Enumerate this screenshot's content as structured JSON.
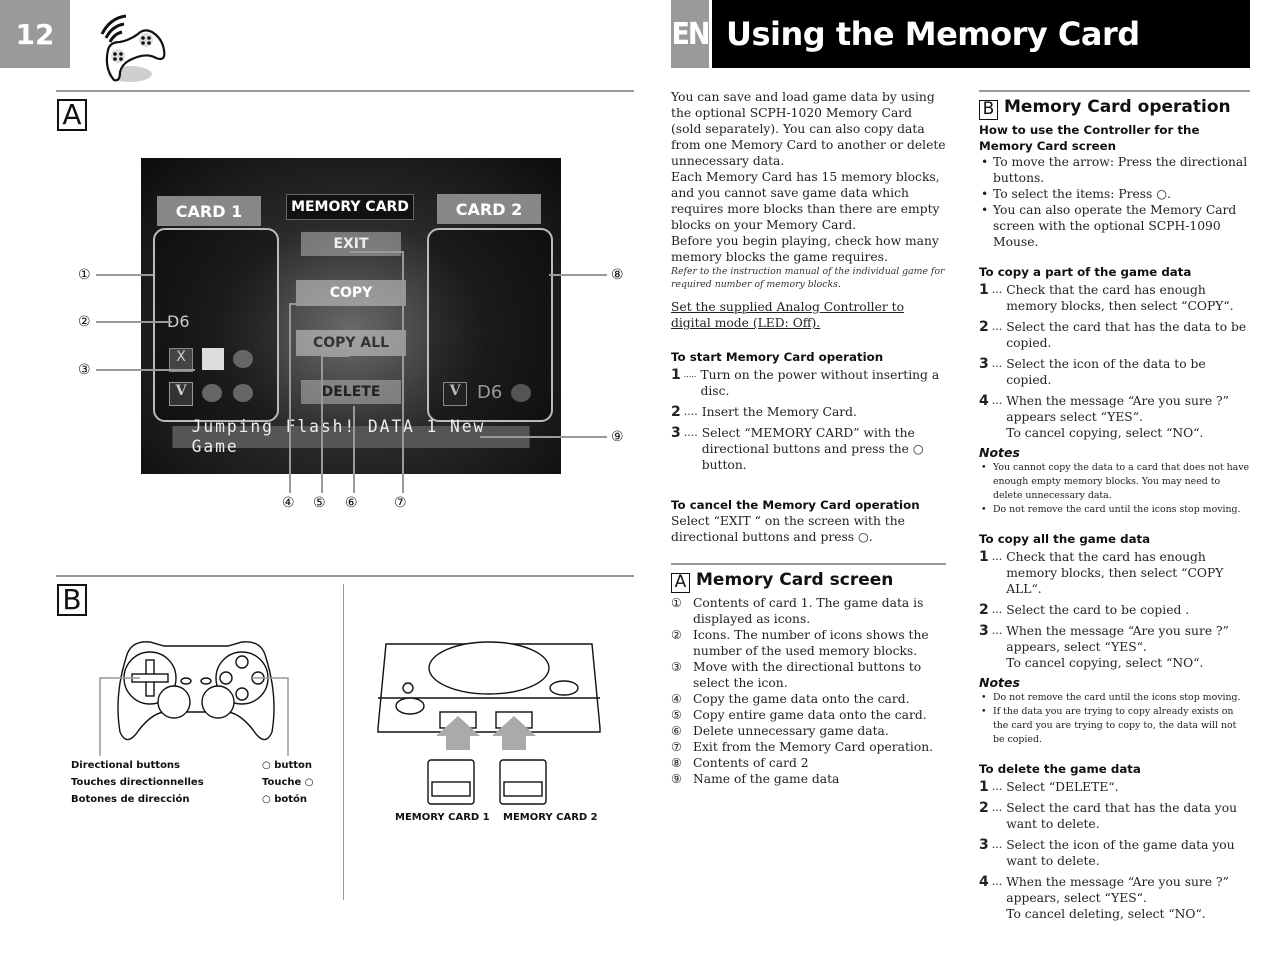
{
  "page_number": "12",
  "language_tab": "EN",
  "page_title": "Using the Memory Card",
  "icons": {
    "header": "controller-icon"
  },
  "figure_a": {
    "label": "A",
    "screen": {
      "card1_label": "CARD 1",
      "card2_label": "CARD 2",
      "header_label": "MEMORY CARD",
      "menu": [
        "EXIT",
        "COPY",
        "COPY ALL",
        "DELETE"
      ],
      "game_data_name": "Jumping Flash! DATA 1 New Game",
      "card1_icons": [
        "D6",
        "X",
        "sketch",
        "3",
        "V",
        "1",
        "2"
      ],
      "card2_icons": [
        "V",
        "D6",
        "2"
      ]
    },
    "callouts": [
      "①",
      "②",
      "③",
      "④",
      "⑤",
      "⑥",
      "⑦",
      "⑧",
      "⑨"
    ]
  },
  "figure_b": {
    "label": "B",
    "controller_labels_left": [
      "Directional buttons",
      "Touches directionnelles",
      "Botones de dirección"
    ],
    "controller_labels_right": [
      "○ button",
      "Touche ○",
      "○ botón"
    ],
    "memory_card_labels": [
      "MEMORY CARD 1",
      "MEMORY CARD 2"
    ]
  },
  "intro": {
    "p1": "You can save and load game data by using the optional SCPH-1020 Memory Card (sold separately). You can also copy data from one Memory Card to another or delete unnecessary data.",
    "p2": "Each Memory Card has 15 memory blocks, and you cannot save game data which requires more blocks than there are empty blocks on your Memory Card.",
    "p3": "Before you begin playing, check how many memory blocks the game requires.",
    "note": "Refer to the instruction manual of the individual game for required number of memory blocks.",
    "underlined": "Set the supplied Analog Controller to digital mode (LED: Off)."
  },
  "start_op": {
    "heading": "To start Memory Card operation",
    "steps": [
      {
        "num": "1",
        "dots": ".....",
        "text": "Turn on the power without inserting a disc."
      },
      {
        "num": "2",
        "dots": "....",
        "text": "Insert the Memory Card."
      },
      {
        "num": "3",
        "dots": "....",
        "text": "Select “MEMORY CARD” with the directional buttons and press the ○ button."
      }
    ]
  },
  "cancel_op": {
    "heading": "To cancel the Memory Card operation",
    "text": "Select “EXIT “ on the screen with the directional buttons and press ○."
  },
  "section_a": {
    "box": "A",
    "title": "Memory Card screen",
    "items": [
      {
        "n": "①",
        "text": "Contents of card 1. The game data is displayed as icons."
      },
      {
        "n": "②",
        "text": "Icons. The number of icons shows the number of the used memory blocks."
      },
      {
        "n": "③",
        "text": "Move with the directional buttons to select the icon."
      },
      {
        "n": "④",
        "text": "Copy the game data onto the card."
      },
      {
        "n": "⑤",
        "text": "Copy entire game data onto the card."
      },
      {
        "n": "⑥",
        "text": "Delete unnecessary game data."
      },
      {
        "n": "⑦",
        "text": "Exit from the Memory Card operation."
      },
      {
        "n": "⑧",
        "text": "Contents of card 2"
      },
      {
        "n": "⑨",
        "text": "Name of the game data"
      }
    ]
  },
  "section_b": {
    "box": "B",
    "title": "Memory Card operation",
    "controller_heading": "How to use the Controller for the Memory Card screen",
    "bullets": [
      "To move the arrow: Press the directional buttons.",
      "To select the items: Press ○.",
      "You can also operate the Memory Card screen with the optional SCPH-1090 Mouse."
    ],
    "copy_part": {
      "heading": "To copy a part of the game data",
      "steps": [
        {
          "num": "1",
          "dots": "...",
          "text": "Check that the card has enough memory blocks, then select “COPY“."
        },
        {
          "num": "2",
          "dots": "...",
          "text": "Select the card that has the data to be copied."
        },
        {
          "num": "3",
          "dots": "...",
          "text": "Select the icon of the data to be copied."
        },
        {
          "num": "4",
          "dots": "...",
          "text": "When the message “Are you sure ?” appears select “YES“.",
          "text2": "To cancel copying, select “NO“."
        }
      ],
      "notes_heading": "Notes",
      "notes": [
        "You cannot copy the data to a card that does not have enough empty memory blocks. You may need to delete unnecessary data.",
        "Do not remove the card until the icons stop moving."
      ]
    },
    "copy_all": {
      "heading": "To copy all the game data",
      "steps": [
        {
          "num": "1",
          "dots": "...",
          "text": "Check that the card has enough memory blocks, then select “COPY ALL“."
        },
        {
          "num": "2",
          "dots": "...",
          "text": "Select the card to be copied ."
        },
        {
          "num": "3",
          "dots": "...",
          "text": "When the message “Are you sure ?” appears, select “YES“.",
          "text2": "To cancel copying, select “NO“."
        }
      ],
      "notes_heading": "Notes",
      "notes": [
        "Do not remove the card until the icons stop moving.",
        "If the data you are trying to copy already exists on the card you are trying to copy to, the data will not be copied."
      ]
    },
    "delete": {
      "heading": "To delete the game data",
      "steps": [
        {
          "num": "1",
          "dots": "...",
          "text": "Select “DELETE“."
        },
        {
          "num": "2",
          "dots": "...",
          "text": "Select the card that has the data you want to delete."
        },
        {
          "num": "3",
          "dots": "...",
          "text": "Select the icon of the game data you want to delete."
        },
        {
          "num": "4",
          "dots": "...",
          "text": "When the message “Are you sure ?” appears, select “YES“.",
          "text2": "To cancel deleting, select “NO“."
        }
      ]
    }
  }
}
